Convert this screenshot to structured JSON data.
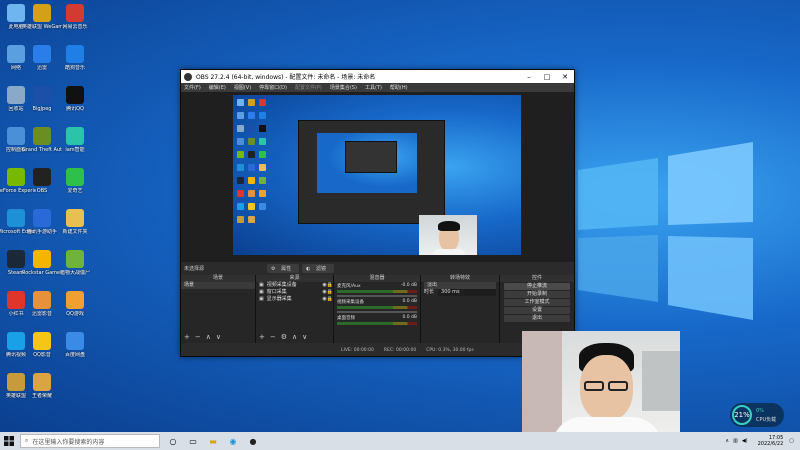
{
  "desktop_icons": [
    {
      "label": "此电脑",
      "color": "#6fb6f0"
    },
    {
      "label": "英雄联盟 WeGame版",
      "color": "#d4a017"
    },
    {
      "label": "网易云音乐",
      "color": "#d33a31"
    },
    {
      "label": "网络",
      "color": "#5aa0e0"
    },
    {
      "label": "迅雷",
      "color": "#2b7de9"
    },
    {
      "label": "酷狗音乐",
      "color": "#1f7fe6"
    },
    {
      "label": "回收站",
      "color": "#8aa8c8"
    },
    {
      "label": "BigJpeg",
      "color": "#1b4fa8"
    },
    {
      "label": "腾讯QQ",
      "color": "#111111"
    },
    {
      "label": "控制面板",
      "color": "#4a90d8"
    },
    {
      "label": "Grand Theft Auto V",
      "color": "#6b8e23"
    },
    {
      "label": "iam智能",
      "color": "#2cc4a8"
    },
    {
      "label": "GeForce Experience",
      "color": "#76b900"
    },
    {
      "label": "OBS",
      "color": "#222222"
    },
    {
      "label": "爱奇艺",
      "color": "#2fc04b"
    },
    {
      "label": "Microsoft Edge",
      "color": "#1e90d6"
    },
    {
      "label": "腾讯手游助手",
      "color": "#2a6ad8"
    },
    {
      "label": "新建文件夹",
      "color": "#e8c052"
    },
    {
      "label": "Steam",
      "color": "#1b2838"
    },
    {
      "label": "Rockstar Games",
      "color": "#f5b400"
    },
    {
      "label": "植物大战僵尸",
      "color": "#6fb33a"
    },
    {
      "label": "小红书",
      "color": "#e0352b"
    },
    {
      "label": "迅雷影音",
      "color": "#e8913a"
    },
    {
      "label": "QQ游戏",
      "color": "#f0a030"
    },
    {
      "label": "腾讯视频",
      "color": "#1aa0e6"
    },
    {
      "label": "QQ影音",
      "color": "#f5c518"
    },
    {
      "label": "百度网盘",
      "color": "#3b8be6"
    },
    {
      "label": "英雄联盟",
      "color": "#c79b3b"
    },
    {
      "label": "王者荣耀",
      "color": "#d9a441"
    }
  ],
  "obs": {
    "title": "OBS 27.2.4 (64-bit, windows) - 配置文件: 未命名 - 场景: 未命名",
    "menu": [
      "文件(F)",
      "编辑(E)",
      "视图(V)",
      "停靠窗口(D)",
      "配置文件(P)",
      "场景集合(S)",
      "工具(T)",
      "帮助(H)"
    ],
    "status_label": "未选择源",
    "props_label": "属性",
    "filters_label": "滤镜",
    "docks": {
      "scenes": {
        "header": "场景",
        "items": [
          "场景"
        ]
      },
      "sources": {
        "header": "来源",
        "items": [
          "视频采集设备",
          "窗口采集",
          "显示器采集"
        ]
      },
      "mixer": {
        "header": "混音器",
        "channels": [
          {
            "name": "麦克风/Aux",
            "db": "-0.0 dB"
          },
          {
            "name": "视频采集设备",
            "db": "0.0 dB"
          },
          {
            "name": "桌面音频",
            "db": "0.0 dB"
          }
        ]
      },
      "transitions": {
        "header": "转场特效",
        "type": "淡出",
        "duration_label": "时长",
        "duration": "300 ms"
      },
      "controls": {
        "header": "控件",
        "buttons": [
          "停止推流",
          "开始录制",
          "工作室模式",
          "设置",
          "退出"
        ]
      }
    },
    "statusbar": {
      "live": "LIVE: 00:00:00",
      "rec": "REC: 00:00:00",
      "cpu": "CPU: 0.3%, 30.00 fps"
    }
  },
  "taskbar": {
    "search_placeholder": "在这里输入你要搜索的内容",
    "time": "17:05",
    "date": "2022/6/22"
  },
  "widget": {
    "percent": "21%",
    "line1": "0%",
    "line2": "CPU负载"
  }
}
